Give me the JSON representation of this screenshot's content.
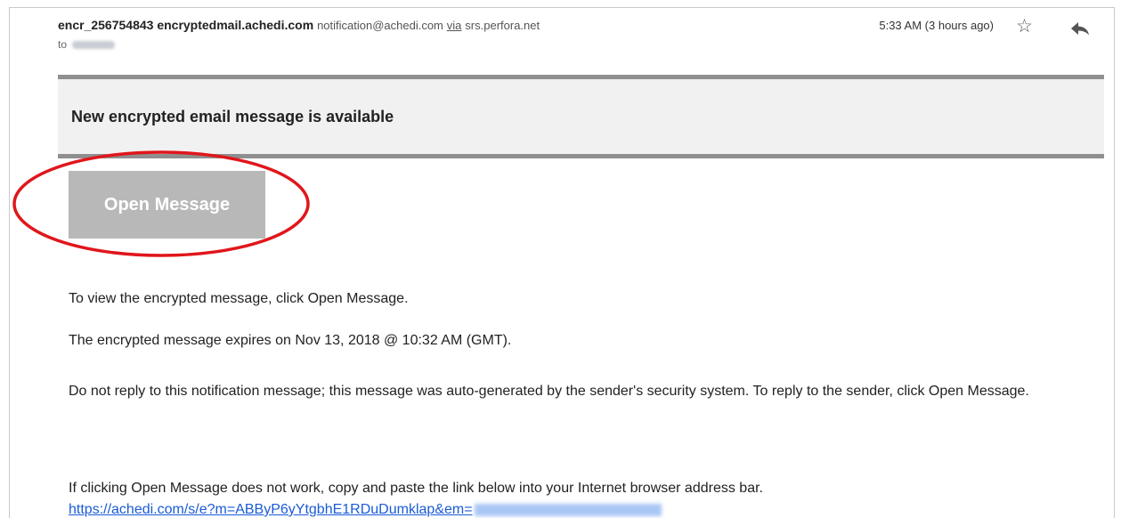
{
  "email": {
    "sender_name": "encr_256754843 encryptedmail.achedi.com",
    "sender_address": "notification@achedi.com",
    "via_label": "via",
    "via_domain": "srs.perfora.net",
    "to_label": "to",
    "time": "5:33 AM (3 hours ago)",
    "icons": {
      "star": "star-icon",
      "reply": "reply-arrow-icon"
    }
  },
  "banner": {
    "title": "New encrypted email message is available"
  },
  "open_button": {
    "label": "Open Message",
    "color": "#b8b8b8"
  },
  "highlight_color": "#e0161b",
  "body": {
    "line1": "To view the encrypted message, click Open Message.",
    "line2": "The encrypted message expires on Nov 13, 2018 @ 10:32 AM (GMT).",
    "line3": "Do not reply to this notification message; this message was auto-generated by the sender's security system. To reply to the sender, click Open Message.",
    "line4": "If clicking Open Message does not work, copy and paste the link below into your Internet browser address bar.",
    "link": "https://achedi.com/s/e?m=ABByP6yYtgbhE1RDuDumklap&em="
  }
}
